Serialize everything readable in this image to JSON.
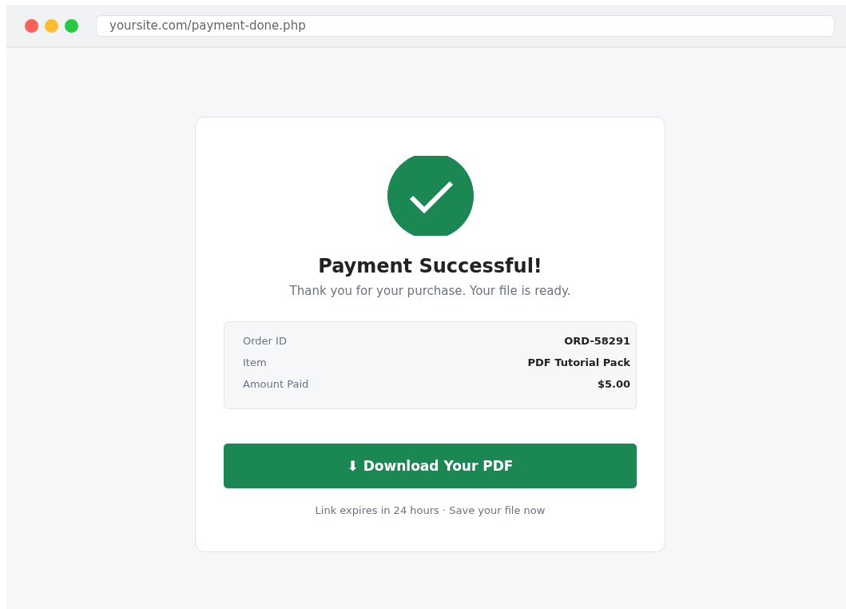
{
  "browser": {
    "url": "yoursite.com/payment-done.php"
  },
  "card": {
    "title": "Payment Successful!",
    "subtitle": "Thank you for your purchase. Your file is ready.",
    "details": [
      {
        "label": "Order ID",
        "value": "ORD-58291"
      },
      {
        "label": "Item",
        "value": "PDF Tutorial Pack"
      },
      {
        "label": "Amount Paid",
        "value": "$5.00"
      }
    ],
    "button": "⬇ Download Your PDF",
    "note": "Link expires in 24 hours · Save your file now"
  }
}
